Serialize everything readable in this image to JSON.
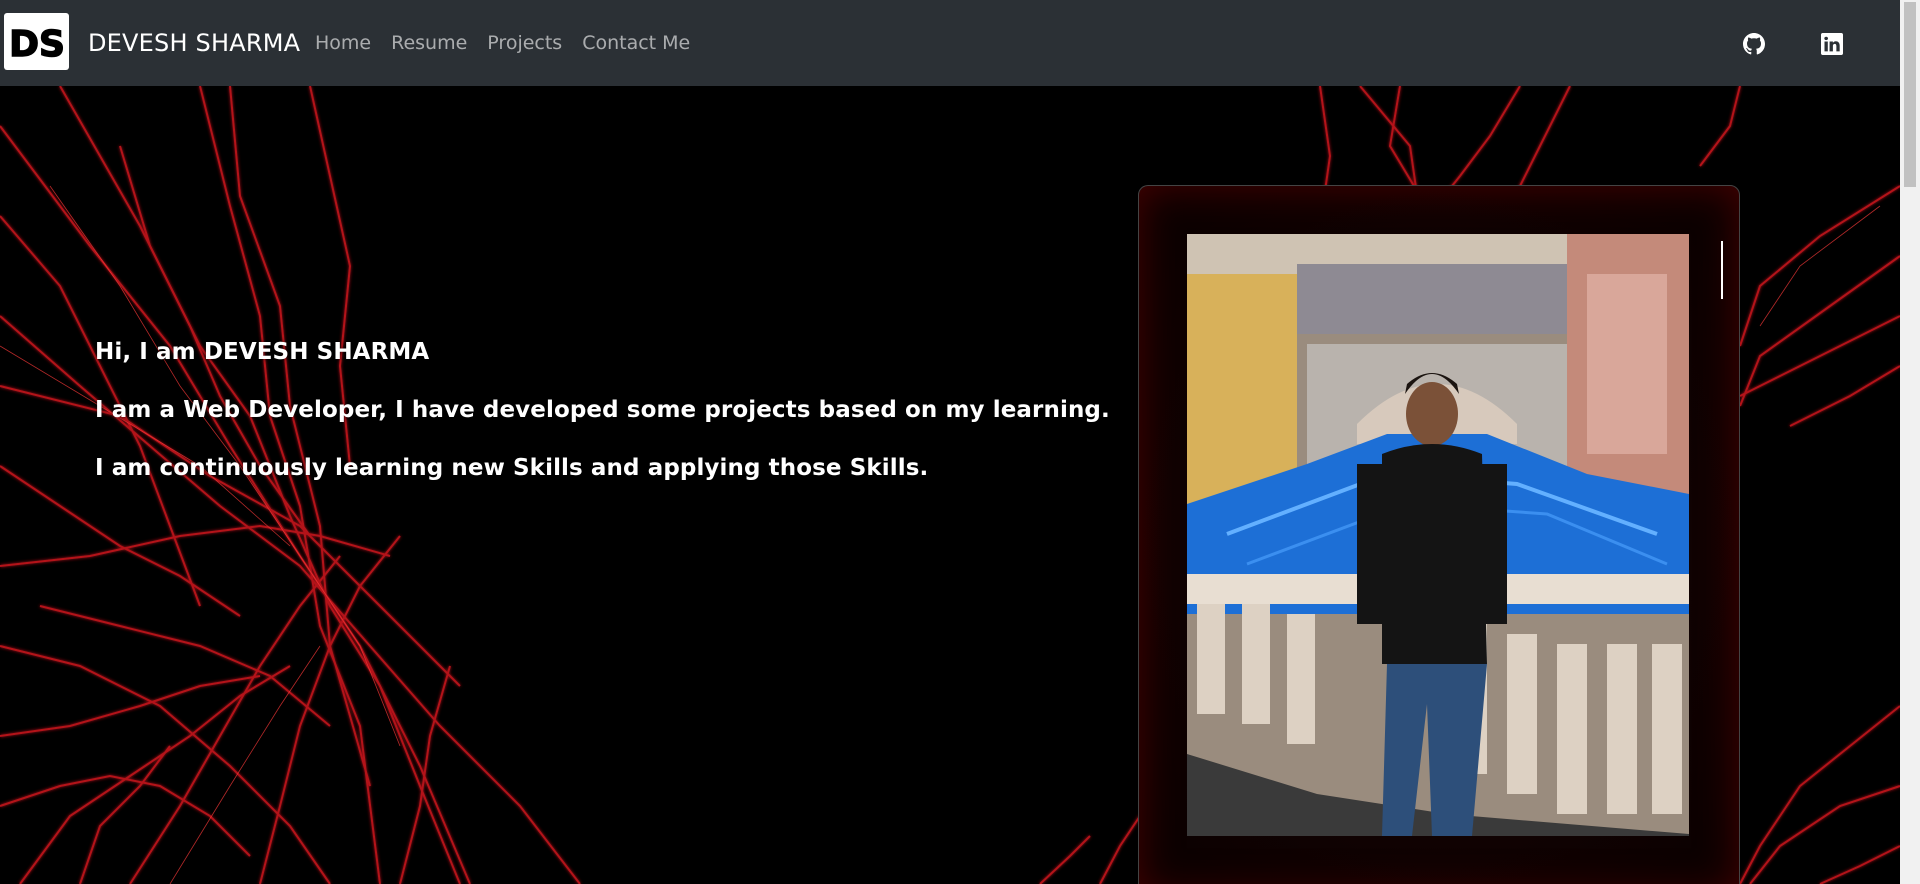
{
  "navbar": {
    "brand_logo_text": "DS",
    "brand_name": "DEVESH SHARMA",
    "links": [
      {
        "label": "Home"
      },
      {
        "label": "Resume"
      },
      {
        "label": "Projects"
      },
      {
        "label": "Contact Me"
      }
    ],
    "icons": [
      "github-icon",
      "linkedin-icon"
    ]
  },
  "hero": {
    "lines": [
      "Hi, I am DEVESH SHARMA",
      "I am a Web Developer, I have developed some projects based on my learning.",
      "I am continuously learning new Skills and applying those Skills."
    ]
  },
  "colors": {
    "navbar_bg": "#2b3035",
    "page_bg": "#000000",
    "accent_red": "#c8141e",
    "text": "#ffffff",
    "nav_link": "rgba(255,255,255,0.6)"
  }
}
